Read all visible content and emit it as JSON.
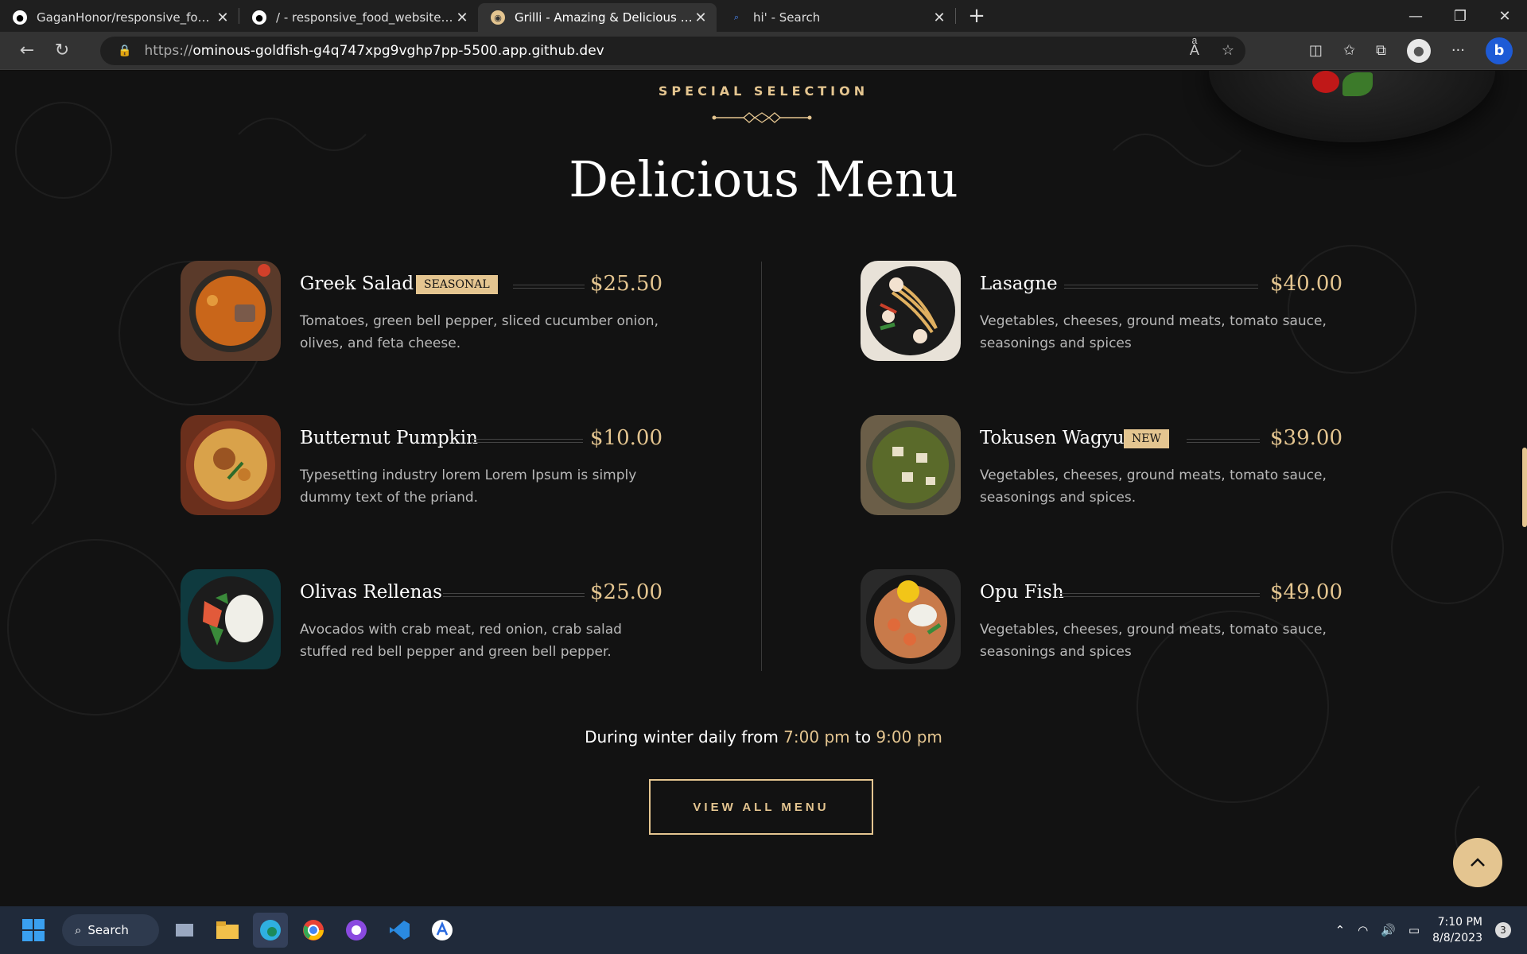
{
  "browser": {
    "tabs": [
      {
        "title": "GaganHonor/responsive_food_website",
        "icon": "github-icon",
        "active": false
      },
      {
        "title": "/ - responsive_food_website [Codespaces]",
        "icon": "github-icon",
        "active": false
      },
      {
        "title": "Grilli - Amazing & Delicious Food",
        "icon": "grilli-icon",
        "active": true
      },
      {
        "title": "hi' - Search",
        "icon": "search-icon",
        "active": false
      }
    ],
    "url_prefix": "https://",
    "url_host": "ominous-goldfish-g4q747xpg9vghp7pp-5500.app.github.dev"
  },
  "section": {
    "subtitle": "SPECIAL SELECTION",
    "title": "Delicious Menu"
  },
  "menu": {
    "left": [
      {
        "name": "Greek Salad",
        "badge": "SEASONAL",
        "price": "$25.50",
        "desc": "Tomatoes, green bell pepper, sliced cucumber onion, olives, and feta cheese.",
        "thumb": "curry"
      },
      {
        "name": "Butternut Pumpkin",
        "badge": "",
        "price": "$10.00",
        "desc": "Typesetting industry lorem Lorem Ipsum is simply dummy text of the priand.",
        "thumb": "biryani"
      },
      {
        "name": "Olivas Rellenas",
        "badge": "",
        "price": "$25.00",
        "desc": "Avocados with crab meat, red onion, crab salad stuffed red bell pepper and green bell pepper.",
        "thumb": "rice-bowl"
      }
    ],
    "right": [
      {
        "name": "Lasagne",
        "badge": "",
        "price": "$40.00",
        "desc": "Vegetables, cheeses, ground meats, tomato sauce, seasonings and spices",
        "thumb": "noodles"
      },
      {
        "name": "Tokusen Wagyu",
        "badge": "NEW",
        "price": "$39.00",
        "desc": "Vegetables, cheeses, ground meats, tomato sauce, seasonings and spices.",
        "thumb": "palak"
      },
      {
        "name": "Opu Fish",
        "badge": "",
        "price": "$49.00",
        "desc": "Vegetables, cheeses, ground meats, tomato sauce, seasonings and spices",
        "thumb": "shrimp"
      }
    ]
  },
  "hours": {
    "prefix": "During winter daily from",
    "start": "7:00 pm",
    "mid": "to",
    "end": "9:00 pm"
  },
  "cta": {
    "label": "VIEW ALL MENU"
  },
  "taskbar": {
    "search_label": "Search",
    "time": "7:10 PM",
    "date": "8/8/2023",
    "notifications": "3"
  },
  "colors": {
    "accent": "#e4c590",
    "background": "#121212"
  }
}
